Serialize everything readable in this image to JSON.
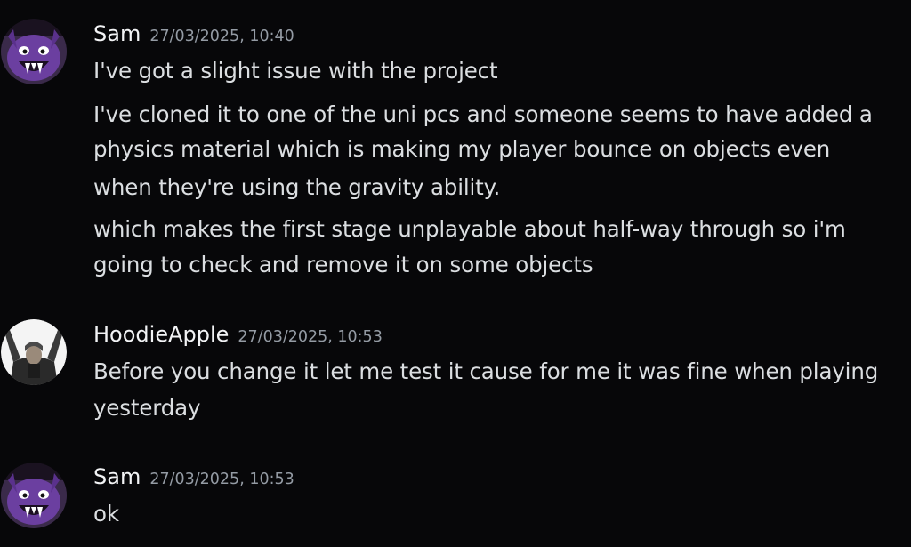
{
  "messages": [
    {
      "author": "Sam",
      "timestamp": "27/03/2025, 10:40",
      "avatar_icon": "purple-monster-avatar-icon",
      "paragraphs": [
        [
          "I've got a slight issue with the project"
        ],
        [
          "I've cloned it to one of the uni pcs and someone seems to have added a",
          "physics material which is making my player bounce on objects even",
          "when they're using the gravity ability."
        ],
        [
          "which makes the first stage unplayable about half-way through so i'm",
          "going to check and remove it on some objects"
        ]
      ]
    },
    {
      "author": "HoodieApple",
      "timestamp": "27/03/2025, 10:53",
      "avatar_icon": "photo-figure-avatar-icon",
      "paragraphs": [
        [
          "Before you change it let me test it cause for me it was fine when playing",
          "yesterday"
        ]
      ]
    },
    {
      "author": "Sam",
      "timestamp": "27/03/2025, 10:53",
      "avatar_icon": "purple-monster-avatar-icon",
      "paragraphs": [
        [
          "ok"
        ]
      ]
    }
  ],
  "colors": {
    "background": "#070709",
    "text": "#dbdee1",
    "username": "#f2f3f5",
    "timestamp": "#949ba4",
    "avatar_purple": "#6b3fa0"
  }
}
